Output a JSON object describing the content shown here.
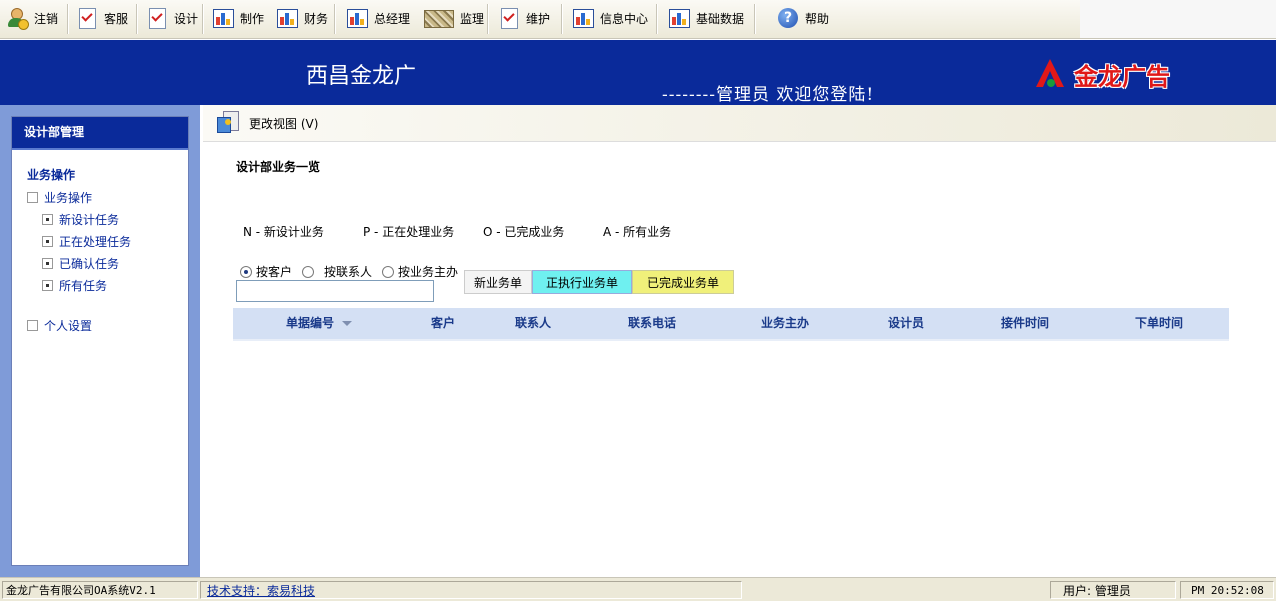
{
  "toolbar": {
    "items": [
      {
        "label": "注销",
        "icon": "logout-user-icon"
      },
      {
        "label": "客服",
        "icon": "doc-check-icon"
      },
      {
        "label": "设计",
        "icon": "doc-check-icon"
      },
      {
        "label": "制作",
        "icon": "bar-chart-icon"
      },
      {
        "label": "财务",
        "icon": "bar-chart-icon"
      },
      {
        "label": "总经理",
        "icon": "bar-chart-icon"
      },
      {
        "label": "监理",
        "icon": "monitor-pattern-icon"
      },
      {
        "label": "维护",
        "icon": "doc-check-icon"
      },
      {
        "label": "信息中心",
        "icon": "bar-chart-icon"
      },
      {
        "label": "基础数据",
        "icon": "bar-chart-icon"
      },
      {
        "label": "帮助",
        "icon": "help-icon"
      }
    ]
  },
  "header": {
    "title": "西昌金龙广",
    "welcome": "--------管理员 欢迎您登陆!",
    "logo_text": "金龙广告"
  },
  "sidebar": {
    "panel_title": "设计部管理",
    "section_label": "业务操作",
    "group_label": "业务操作",
    "items": [
      {
        "label": "新设计任务"
      },
      {
        "label": "正在处理任务"
      },
      {
        "label": "已确认任务"
      },
      {
        "label": "所有任务"
      }
    ],
    "personal_label": "个人设置"
  },
  "main": {
    "view_menu": "更改视图 (V)",
    "list_title": "设计部业务一览",
    "legend": [
      {
        "text": "N - 新设计业务"
      },
      {
        "text": "P - 正在处理业务"
      },
      {
        "text": "O - 已完成业务"
      },
      {
        "text": "A - 所有业务"
      }
    ],
    "filters": [
      {
        "label": "按客户",
        "checked": true
      },
      {
        "label": "按联系人",
        "checked": false
      },
      {
        "label": "按业务主办",
        "checked": false
      }
    ],
    "search_value": "",
    "tabs": [
      {
        "label": "新业务单",
        "color": "#f4f4f4"
      },
      {
        "label": "正执行业务单",
        "color": "#6ff0f0"
      },
      {
        "label": "已完成业务单",
        "color": "#f0f07a"
      }
    ],
    "columns": [
      "单据编号",
      "客户",
      "联系人",
      "联系电话",
      "业务主办",
      "设计员",
      "接件时间",
      "下单时间"
    ]
  },
  "statusbar": {
    "company": "金龙广告有限公司OA系统V2.1",
    "support": "技术支持：索易科技",
    "user": "用户: 管理员",
    "time": "PM 20:52:08"
  },
  "colors": {
    "header_bg": "#0a2a9a",
    "sidebar_bg": "#7f9bd8",
    "grid_head_bg": "#d4e0f4"
  }
}
